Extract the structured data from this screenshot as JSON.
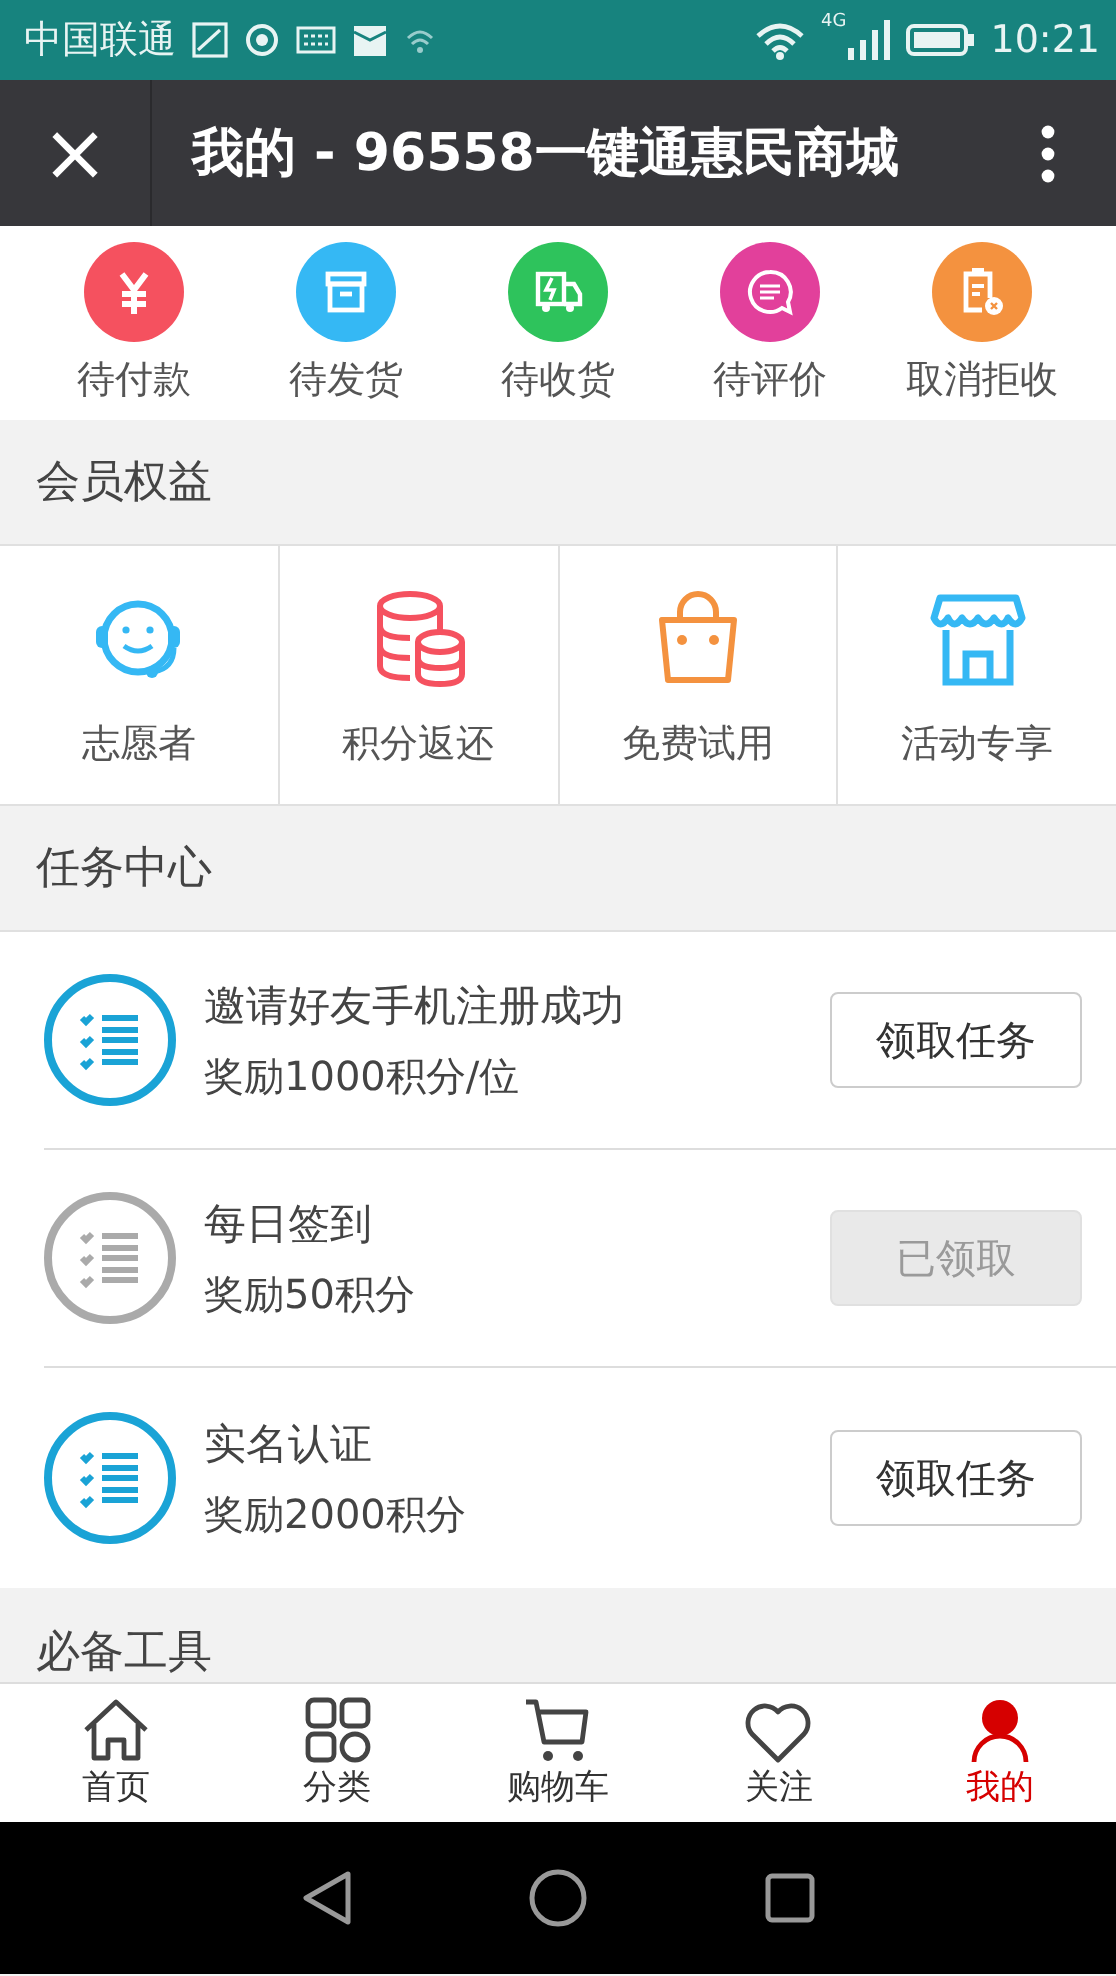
{
  "status_bar": {
    "carrier": "中国联通",
    "network": "4G",
    "time": "10:21"
  },
  "toolbar": {
    "close": "×",
    "title": "我的 - 96558一键通惠民商城"
  },
  "orders": [
    {
      "label": "待付款",
      "color": "#f5515f",
      "kind": "yen"
    },
    {
      "label": "待发货",
      "color": "#35b8f4",
      "kind": "box"
    },
    {
      "label": "待收货",
      "color": "#2ec35c",
      "kind": "truck"
    },
    {
      "label": "待评价",
      "color": "#e2409b",
      "kind": "chat"
    },
    {
      "label": "取消拒收",
      "color": "#f4923f",
      "kind": "clipboard"
    }
  ],
  "sections": [
    {
      "title": "会员权益",
      "kind": "benefits",
      "items": [
        {
          "label": "志愿者",
          "kind": "headset"
        },
        {
          "label": "积分返还",
          "kind": "coins"
        },
        {
          "label": "免费试用",
          "kind": "bag"
        },
        {
          "label": "活动专享",
          "kind": "shop"
        }
      ]
    },
    {
      "title": "任务中心",
      "kind": "tasks",
      "tasks": [
        {
          "title": "邀请好友手机注册成功",
          "reward": "奖励1000积分/位",
          "button": "领取任务",
          "disabled": false
        },
        {
          "title": "每日签到",
          "reward": "奖励50积分",
          "button": "已领取",
          "disabled": true
        },
        {
          "title": "实名认证",
          "reward": "奖励2000积分",
          "button": "领取任务",
          "disabled": false
        }
      ]
    },
    {
      "title": "必备工具",
      "kind": "tools"
    }
  ],
  "tab_bar": [
    {
      "label": "首页",
      "kind": "home",
      "selected": false
    },
    {
      "label": "分类",
      "kind": "grid",
      "selected": false
    },
    {
      "label": "购物车",
      "kind": "cart",
      "selected": false
    },
    {
      "label": "关注",
      "kind": "heart",
      "selected": false
    },
    {
      "label": "我的",
      "kind": "person",
      "selected": true
    }
  ]
}
